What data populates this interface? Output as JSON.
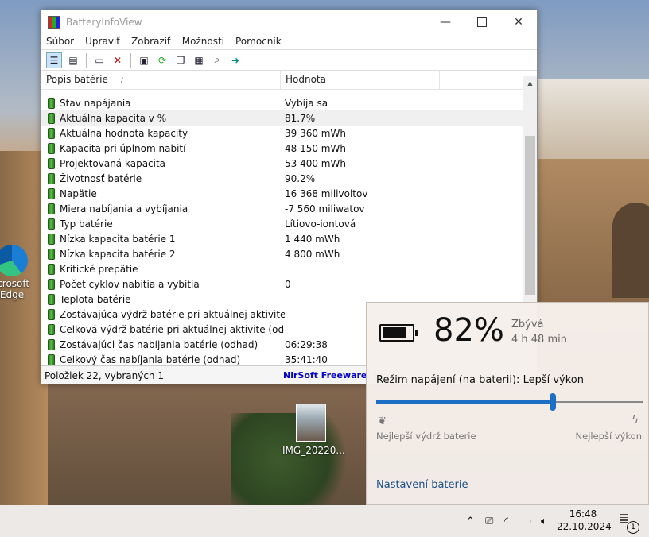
{
  "desktop": {
    "icons": [
      {
        "label_line1": "icrosoft",
        "label_line2": "Edge"
      },
      {
        "label": "IMG_20220..."
      }
    ]
  },
  "window": {
    "title": "BatteryInfoView",
    "controls": {
      "minimize": "—",
      "close": "✕"
    },
    "menu": [
      "Súbor",
      "Upraviť",
      "Zobraziť",
      "Možnosti",
      "Pomocník"
    ],
    "toolbar_icons": [
      "properties-icon",
      "list-icon",
      "window-icon",
      "delete-icon",
      "save-icon",
      "refresh-icon",
      "copy-icon",
      "html-report-icon",
      "search-icon",
      "exit-icon"
    ],
    "columns": {
      "desc": "Popis batérie",
      "sort_indicator": "/",
      "value": "Hodnota"
    },
    "rows": [
      {
        "desc": "Stav napájania",
        "value": "Vybíja sa"
      },
      {
        "desc": "Aktuálna kapacita v %",
        "value": "81.7%"
      },
      {
        "desc": "Aktuálna hodnota kapacity",
        "value": "39 360 mWh"
      },
      {
        "desc": "Kapacita pri úplnom nabití",
        "value": "48 150 mWh"
      },
      {
        "desc": "Projektovaná kapacita",
        "value": "53 400 mWh"
      },
      {
        "desc": "Životnosť batérie",
        "value": "90.2%"
      },
      {
        "desc": "Napätie",
        "value": "16 368 milivoltov"
      },
      {
        "desc": "Miera nabíjania a vybíjania",
        "value": "-7 560 miliwatov"
      },
      {
        "desc": "Typ batérie",
        "value": "Lítiovo-iontová"
      },
      {
        "desc": "Nízka kapacita batérie 1",
        "value": "1 440 mWh"
      },
      {
        "desc": "Nízka kapacita batérie 2",
        "value": "4 800 mWh"
      },
      {
        "desc": "Kritické prepätie",
        "value": ""
      },
      {
        "desc": "Počet cyklov nabitia a vybitia",
        "value": "0"
      },
      {
        "desc": "Teplota batérie",
        "value": ""
      },
      {
        "desc": "Zostávajúca výdrž batérie pri aktuálnej aktivite (od...",
        "value": ""
      },
      {
        "desc": "Celková výdrž batérie pri aktuálnej aktivite (odhad)",
        "value": ""
      },
      {
        "desc": "Zostávajúci čas nabíjania batérie (odhad)",
        "value": "06:29:38"
      },
      {
        "desc": "Celkový čas nabíjania batérie (odhad)",
        "value": "35:41:40"
      }
    ],
    "status": {
      "left": "Položiek 22, vybraných 1",
      "right": "NirSoft Freeware. I"
    }
  },
  "flyout": {
    "percent": "82%",
    "battery_level": 0.82,
    "remaining_label": "Zbývá",
    "remaining_value": "4 h 48 min",
    "mode_label": "Režim napájení (na baterii): Lepší výkon",
    "slider_position": 0.66,
    "left_label": "Nejlepší výdrž baterie",
    "right_label": "Nejlepší výkon",
    "settings_link": "Nastavení baterie"
  },
  "taskbar": {
    "time": "16:48",
    "date": "22.10.2024",
    "notification_count": "1"
  }
}
